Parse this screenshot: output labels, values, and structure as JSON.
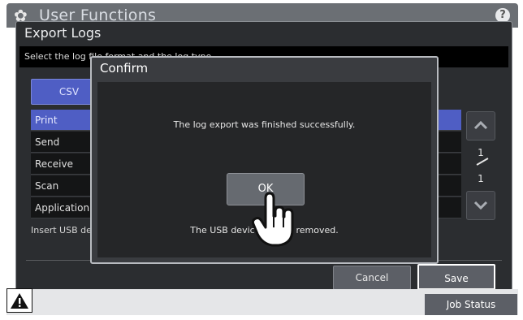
{
  "header": {
    "title": "User Functions",
    "help_label": "?"
  },
  "panel": {
    "title": "Export Logs",
    "instruction": "Select the log file format and the log type.",
    "format_button": "CSV",
    "log_types": [
      "Print",
      "Send",
      "Receive",
      "Scan",
      "Application"
    ],
    "selected_index": 0,
    "usb_note": "Insert USB device and press [Save].",
    "pager": {
      "current": "1",
      "total": "1"
    },
    "cancel_label": "Cancel",
    "save_label": "Save"
  },
  "dialog": {
    "title": "Confirm",
    "message": "The log export was finished successfully.",
    "ok_label": "OK",
    "usb_message": "The USB device can be removed."
  },
  "footer": {
    "job_status_label": "Job Status"
  },
  "colors": {
    "accent": "#4f5ec4",
    "panel_bg": "#2b2d30",
    "dialog_bg": "#252628"
  },
  "icons": [
    "gear-icon",
    "help-icon",
    "scroll-up-icon",
    "scroll-down-icon",
    "warning-icon",
    "hand-pointer-icon"
  ]
}
